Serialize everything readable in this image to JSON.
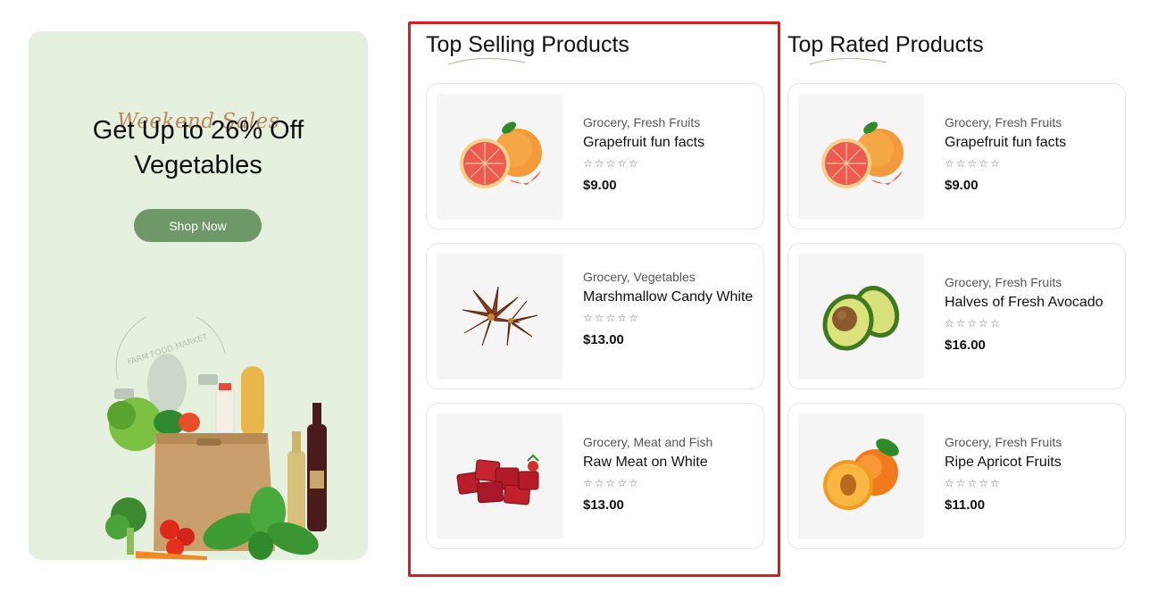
{
  "promo": {
    "eyebrow": "Weekend Sales",
    "title_line1": "Get Up to 26% Off",
    "title_line2": "Vegetables",
    "button_label": "Shop Now",
    "badge_text": "FARM FOOD MARKET",
    "accent_color": "#6e9868",
    "background_color": "#e5f0de"
  },
  "top_selling": {
    "title": "Top Selling Products",
    "items": [
      {
        "category": "Grocery, Fresh Fruits",
        "name": "Grapefruit fun facts",
        "stars": "☆☆☆☆☆",
        "price": "$9.00",
        "image": "grapefruit"
      },
      {
        "category": "Grocery, Vegetables",
        "name": "Marshmallow Candy White",
        "stars": "☆☆☆☆☆",
        "price": "$13.00",
        "image": "star-anise"
      },
      {
        "category": "Grocery, Meat and Fish",
        "name": "Raw Meat on White",
        "stars": "☆☆☆☆☆",
        "price": "$13.00",
        "image": "raw-meat"
      }
    ]
  },
  "top_rated": {
    "title": "Top Rated Products",
    "items": [
      {
        "category": "Grocery, Fresh Fruits",
        "name": "Grapefruit fun facts",
        "stars": "☆☆☆☆☆",
        "price": "$9.00",
        "image": "grapefruit"
      },
      {
        "category": "Grocery, Fresh Fruits",
        "name": "Halves of Fresh Avocado",
        "stars": "☆☆☆☆☆",
        "price": "$16.00",
        "image": "avocado"
      },
      {
        "category": "Grocery, Fresh Fruits",
        "name": "Ripe Apricot Fruits",
        "stars": "☆☆☆☆☆",
        "price": "$11.00",
        "image": "apricot"
      }
    ]
  },
  "highlight_color": "#d71d1d"
}
